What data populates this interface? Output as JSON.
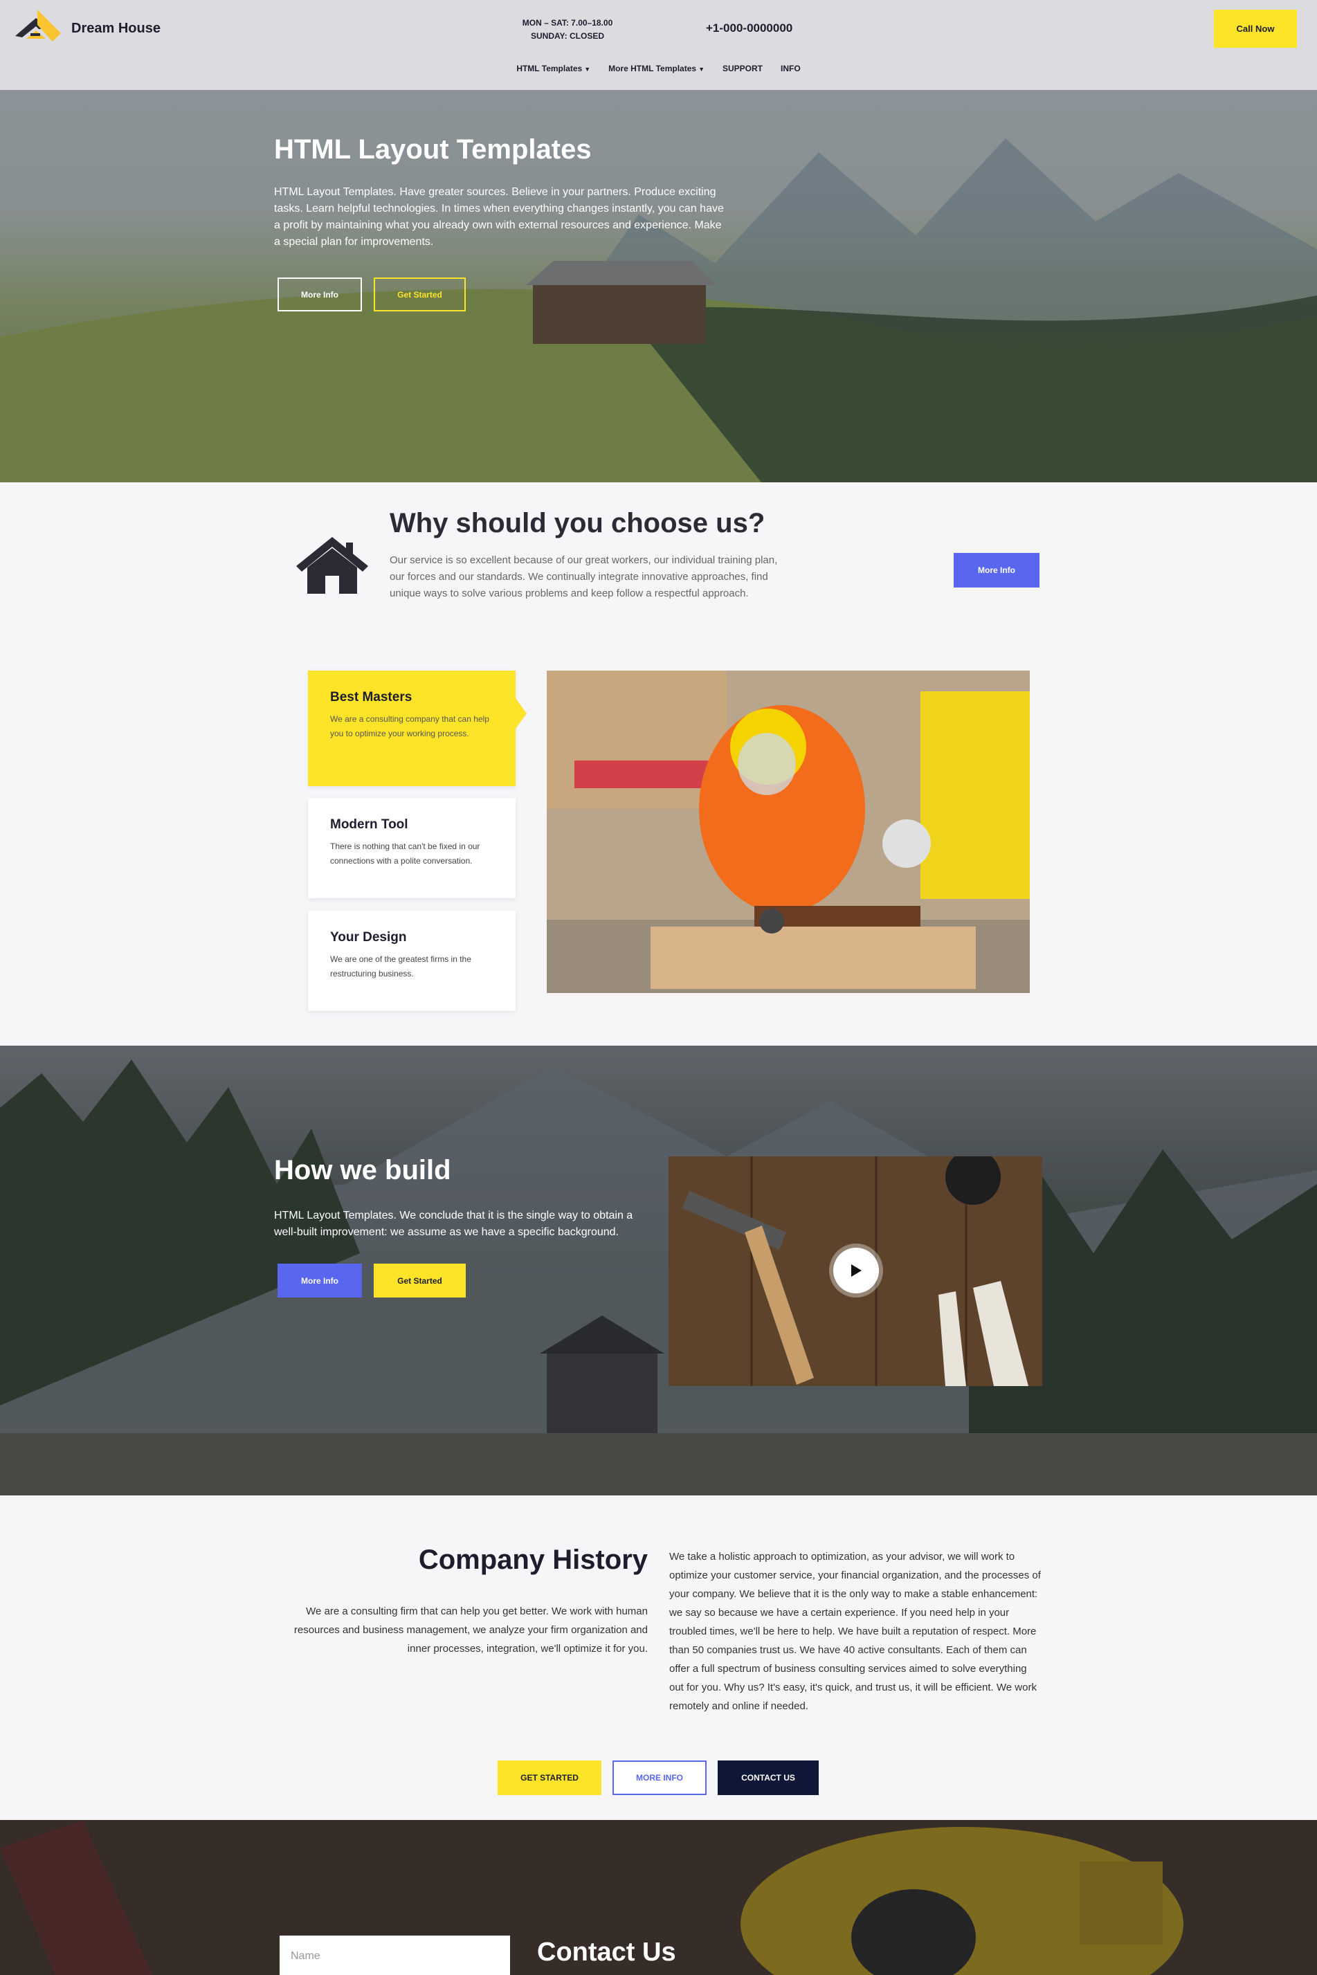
{
  "header": {
    "brand": "Dream House",
    "hours_line1": "MON – SAT: 7.00–18.00",
    "hours_line2": "SUNDAY: CLOSED",
    "phone": "+1-000-0000000",
    "call_button": "Call Now"
  },
  "nav": {
    "items": [
      {
        "label": "HTML Templates",
        "has_dropdown": true
      },
      {
        "label": "More HTML Templates",
        "has_dropdown": true
      },
      {
        "label": "SUPPORT",
        "has_dropdown": false
      },
      {
        "label": "INFO",
        "has_dropdown": false
      }
    ]
  },
  "hero": {
    "title": "HTML Layout Templates",
    "text": "HTML Layout Templates. Have greater sources. Believe in your partners. Produce exciting tasks. Learn helpful technologies. In times when everything changes instantly, you can have a profit by maintaining what you already own with external resources and experience. Make a special plan for improvements.",
    "btn_more": "More Info",
    "btn_start": "Get Started"
  },
  "why": {
    "title": "Why should you choose us?",
    "text": "Our service is so excellent because of our great workers, our individual training plan, our forces and our standards. We continually integrate innovative approaches, find unique ways to solve various problems and keep follow a respectful approach.",
    "btn": "More Info"
  },
  "features": [
    {
      "title": "Best Masters",
      "text": "We are a consulting company that can help you to optimize your working process."
    },
    {
      "title": "Modern Tool",
      "text": "There is nothing that can't be fixed in our connections with a polite conversation."
    },
    {
      "title": "Your Design",
      "text": "We are one of the greatest firms in the restructuring business."
    }
  ],
  "build": {
    "title": "How we build",
    "text": "HTML Layout Templates. We conclude that it is the single way to obtain a well-built improvement: we assume as we have a specific background.",
    "btn_more": "More Info",
    "btn_start": "Get Started"
  },
  "history": {
    "title": "Company History",
    "left_text": "We are a consulting firm that can help you get better. We work with human resources and business management, we analyze your firm organization and inner processes, integration, we'll optimize it for you.",
    "right_text": "We take a holistic approach to optimization, as your advisor, we will work to optimize your customer service, your financial organization, and the processes of your company. We believe that it is the only way to make a stable enhancement: we say so because we have a certain experience. If you need help in your troubled times, we'll be here to help. We have built a reputation of respect. More than 50 companies trust us. We have 40 active consultants. Each of them can offer a full spectrum of business consulting services aimed to solve everything out for you. Why us? It's easy, it's quick, and trust us, it will be efficient. We work remotely and online if needed.",
    "btn_start": "GET STARTED",
    "btn_more": "MORE INFO",
    "btn_contact": "CONTACT US"
  },
  "contact": {
    "name_placeholder": "Name",
    "title": "Contact Us"
  },
  "colors": {
    "accent_yellow": "#fde428",
    "accent_blue": "#5967f0",
    "dark_navy": "#0e1738",
    "header_bg": "#dcdbdf"
  },
  "icons": [
    "logo-house-icon",
    "caret-down-icon",
    "house-icon",
    "play-icon"
  ]
}
